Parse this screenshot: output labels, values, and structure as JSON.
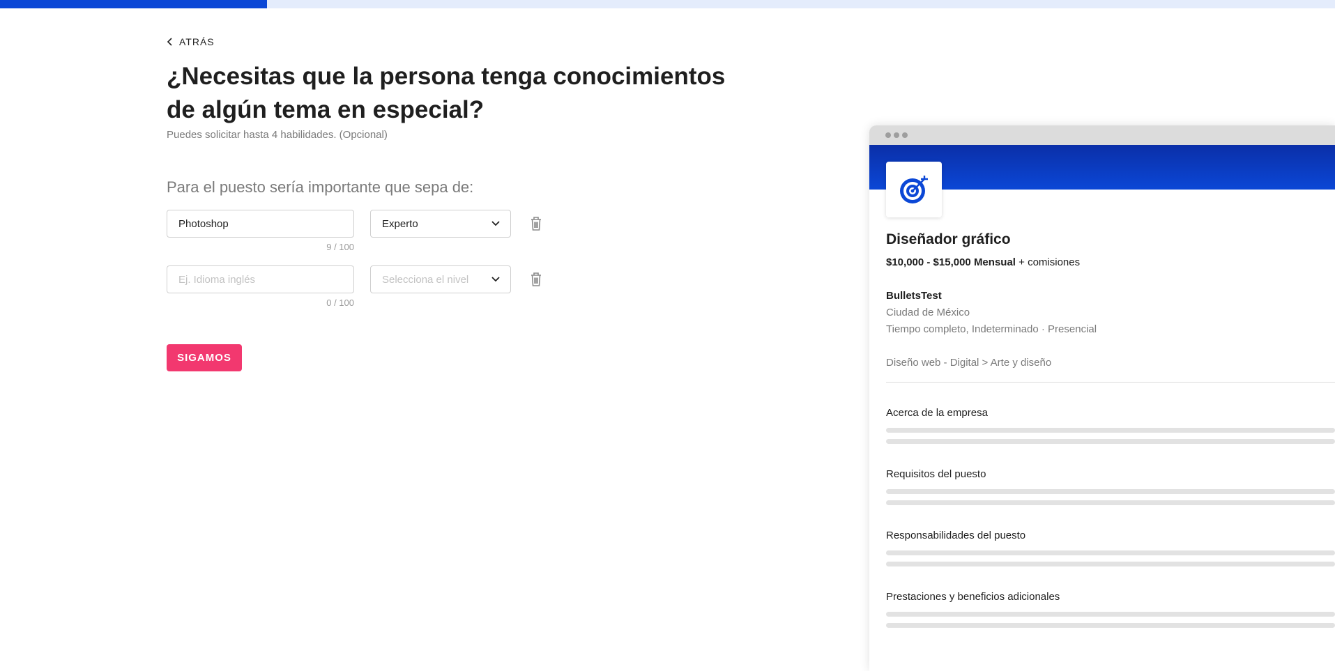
{
  "progress": {
    "fraction": 0.2
  },
  "nav": {
    "back_label": "ATRÁS"
  },
  "page": {
    "title": "¿Necesitas que la persona tenga conocimientos de algún tema en especial?",
    "subtitle": "Puedes solicitar hasta 4 habilidades. (Opcional)",
    "section_label": "Para el puesto sería importante que sepa de:"
  },
  "skills": [
    {
      "value": "Photoshop",
      "placeholder": "Ej. Idioma inglés",
      "counter": "9 / 100",
      "level": "Experto",
      "level_placeholder": "Selecciona el nivel"
    },
    {
      "value": "",
      "placeholder": "Ej. Idioma inglés",
      "counter": "0 / 100",
      "level": "",
      "level_placeholder": "Selecciona el nivel"
    }
  ],
  "actions": {
    "continue_label": "SIGAMOS"
  },
  "preview": {
    "job_title": "Diseñador gráfico",
    "salary": "$10,000 - $15,000 Mensual",
    "salary_extra": " + comisiones",
    "company": "BulletsTest",
    "city": "Ciudad de México",
    "job_type": "Tiempo completo, Indeterminado · Presencial",
    "category": "Diseño web - Digital > Arte y diseño",
    "sections": [
      "Acerca de la empresa",
      "Requisitos del puesto",
      "Responsabilidades del puesto",
      "Prestaciones y beneficios adicionales"
    ]
  },
  "colors": {
    "accent": "#0b47d6",
    "primary_button": "#f2386f",
    "progress_track": "#e4ecfc"
  },
  "icons": [
    "chevron-left-icon",
    "chevron-down-icon",
    "trash-icon",
    "target-icon"
  ]
}
